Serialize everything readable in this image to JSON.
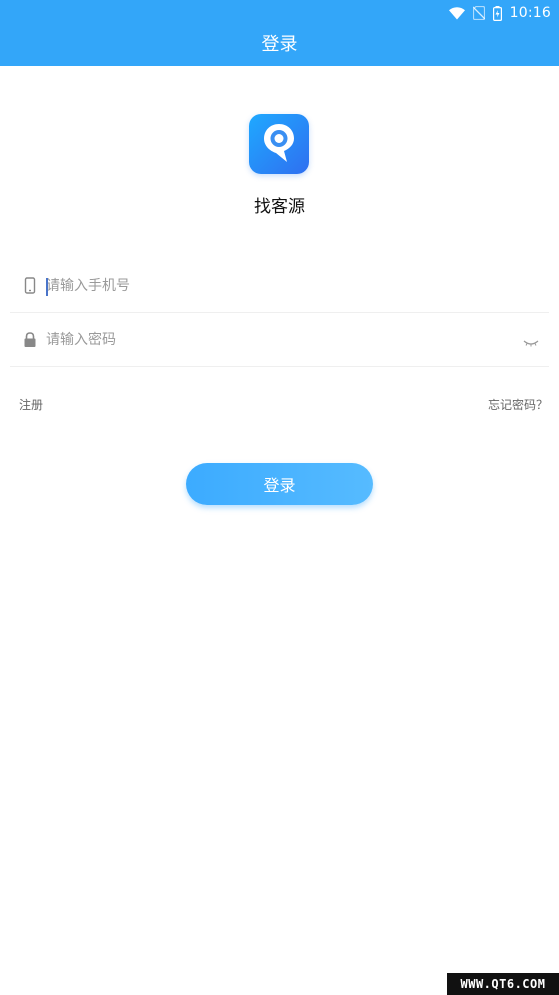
{
  "status_bar": {
    "time": "10:16",
    "icons": [
      "wifi-icon",
      "no-sim-icon",
      "battery-charging-icon"
    ]
  },
  "header": {
    "title": "登录"
  },
  "app": {
    "name": "找客源",
    "logo_icon": "map-pin-icon"
  },
  "form": {
    "phone": {
      "icon": "phone-icon",
      "placeholder": "请输入手机号",
      "value": ""
    },
    "password": {
      "icon": "lock-icon",
      "placeholder": "请输入密码",
      "value": "",
      "toggle_icon": "eye-closed-icon"
    }
  },
  "links": {
    "register": "注册",
    "forgot_password": "忘记密码？"
  },
  "login_button": {
    "label": "登录"
  },
  "watermark": {
    "text": "WWW.QT6.COM"
  },
  "colors": {
    "primary": "#33a6f9",
    "button": "#47b3ff",
    "placeholder": "#9a9a9a"
  }
}
